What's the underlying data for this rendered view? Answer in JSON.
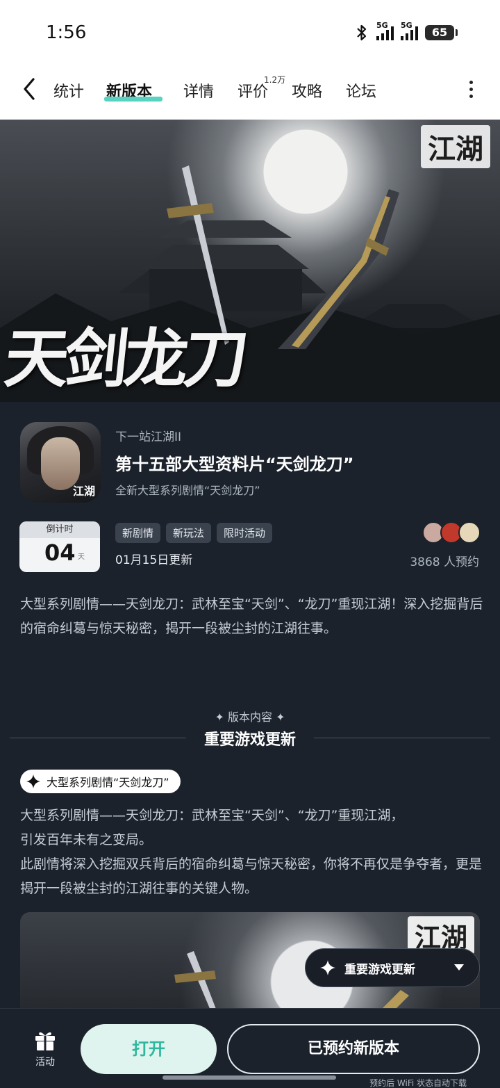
{
  "status_bar": {
    "time": "1:56",
    "signal1_label": "5G",
    "signal2_label": "5G",
    "battery": "65"
  },
  "nav": {
    "tabs": [
      {
        "label": "统计"
      },
      {
        "label": "新版本"
      },
      {
        "label": "详情"
      },
      {
        "label": "评价"
      },
      {
        "label": "攻略"
      },
      {
        "label": "论坛"
      }
    ],
    "review_count": "1.2万",
    "active_color": "#57d3c0"
  },
  "banner": {
    "title": "天剑龙刀",
    "logo": "江湖"
  },
  "game": {
    "icon_mark": "江湖",
    "developer": "下一站江湖II",
    "title": "第十五部大型资料片“天剑龙刀”",
    "subtitle": "全新大型系列剧情“天剑龙刀”"
  },
  "countdown": {
    "label": "倒计时",
    "value": "04",
    "unit": "天"
  },
  "tags": [
    "新剧情",
    "新玩法",
    "限时活动"
  ],
  "update_date": "01月15日更新",
  "reservation": {
    "count_text": "3868 人预约",
    "avatar_colors": [
      "#c9a9a0",
      "#c0392b",
      "#e6d7b8"
    ]
  },
  "description": "大型系列剧情——天剑龙刀：武林至宝“天剑”、“龙刀”重现江湖！深入挖掘背后的宿命纠葛与惊天秘密，揭开一段被尘封的江湖往事。",
  "section": {
    "small_label": "版本内容",
    "big_title": "重要游戏更新"
  },
  "feature": {
    "pill_label": "大型系列剧情“天剑龙刀”",
    "text_line1": "大型系列剧情——天剑龙刀：武林至宝“天剑”、“龙刀”重现江湖，",
    "text_line2": "引发百年未有之变局。",
    "text_line3": "此剧情将深入挖掘双兵背后的宿命纠葛与惊天秘密，你将不再仅是争夺者，更是揭开一段被尘封的江湖往事的关键人物。",
    "image_logo": "江湖"
  },
  "floating_menu": {
    "label": "重要游戏更新"
  },
  "bottom_bar": {
    "activity_label": "活动",
    "open_label": "打开",
    "reserved_label": "已预约新版本",
    "hint": "预约后 WiFi 状态自动下载",
    "accent": "#2fb79d"
  }
}
